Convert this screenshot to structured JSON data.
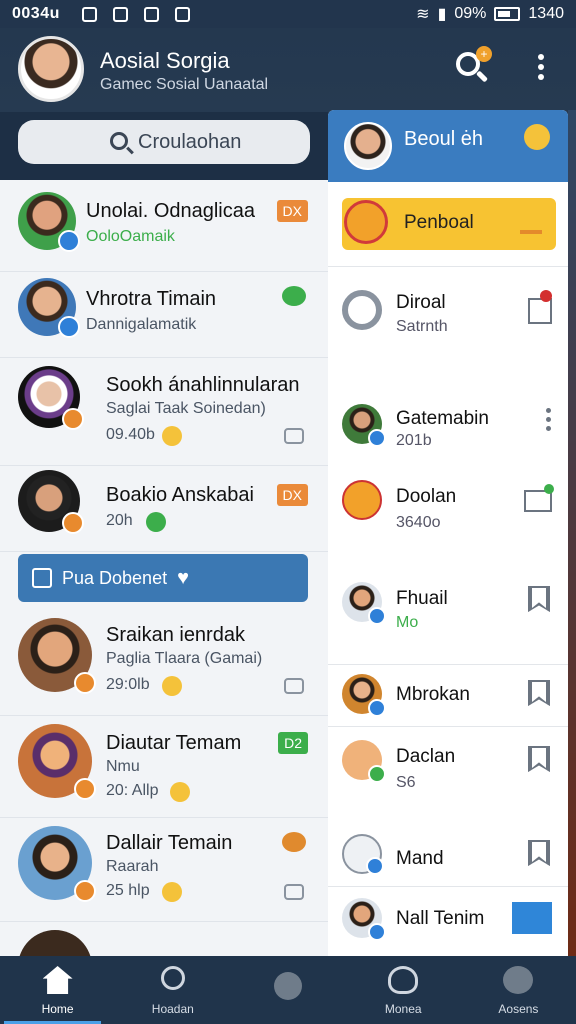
{
  "status_bar": {
    "time": "0034u",
    "battery": "09%",
    "clock": "1340"
  },
  "header": {
    "title": "Aosial Sorgia",
    "subtitle": "Gamec Sosial Uanaatal",
    "search_badge": "+"
  },
  "search": {
    "placeholder": "Croulaohan"
  },
  "chats": [
    {
      "name": "Unolai. Odnaglicaa",
      "sub": "OoloOamaik",
      "meta": "",
      "tag": "DX",
      "tag_color": "#ea8a3a",
      "avatar_color": "#5a8fca"
    },
    {
      "name": "Vhrotra Timain",
      "sub": "Dannigalamatik",
      "meta": "",
      "tag": "",
      "tag_color": "",
      "avatar_color": "#3f78b8"
    },
    {
      "name": "Sookh ánahlinnularan",
      "sub": "Saglai Taak Soinedan)",
      "meta": "09.40b",
      "tag": "",
      "tag_color": "",
      "avatar_color": "#2a2440"
    },
    {
      "name": "Boakio Anskabai",
      "sub": "",
      "meta": "20h",
      "tag": "DX",
      "tag_color": "#ea8a3a",
      "avatar_color": "#272727"
    },
    {
      "name": "Sraikan ienrdak",
      "sub": "Paglia Tlaara (Gamai)",
      "meta": "29:0lb",
      "tag": "",
      "tag_color": "",
      "avatar_color": "#8a5a3a"
    },
    {
      "name": "Diautar Temam",
      "sub": "Nmu",
      "meta": "20: Allp",
      "tag": "D2",
      "tag_color": "#3cae4b",
      "avatar_color": "#c8733a"
    },
    {
      "name": "Dallair Temain",
      "sub": "Raarah",
      "meta": "25 hlp",
      "tag": "",
      "tag_color": "",
      "avatar_color": "#6aa0d0"
    }
  ],
  "new_chat": {
    "label": "Pua Dobenet"
  },
  "panel": {
    "title": "Beoul ėh",
    "highlight": "Penboal",
    "rows": [
      {
        "name": "Diroal",
        "sub": "Satrnth",
        "action": "bookmark"
      },
      {
        "name": "Gatemabin",
        "sub": "201b",
        "action": "more"
      },
      {
        "name": "Doolan",
        "sub": "3640o",
        "action": "mail"
      },
      {
        "name": "Fhuail",
        "sub": "Mo",
        "action": "bookmark"
      },
      {
        "name": "Mbrokan",
        "sub": "",
        "action": "bookmark"
      },
      {
        "name": "Daclan",
        "sub": "S6",
        "action": "bookmark"
      },
      {
        "name": "Mand",
        "sub": "",
        "action": "bookmark"
      },
      {
        "name": "Nall Tenim",
        "sub": "",
        "action": "mail-blue"
      }
    ]
  },
  "bottom_nav": [
    {
      "label": "Home",
      "icon": "home-icon",
      "active": true
    },
    {
      "label": "Hoadan",
      "icon": "search-icon",
      "active": false
    },
    {
      "label": "",
      "icon": "dot-icon",
      "active": false
    },
    {
      "label": "Monea",
      "icon": "heart-icon",
      "active": false
    },
    {
      "label": "Aosens",
      "icon": "person-icon",
      "active": false
    }
  ]
}
